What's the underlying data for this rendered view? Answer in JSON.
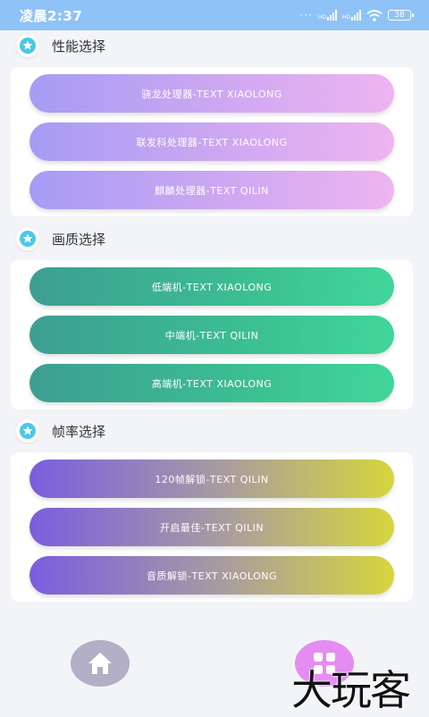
{
  "status_bar": {
    "time": "凌晨2:37",
    "signal_labels": [
      "HD",
      "HD"
    ],
    "battery": "38"
  },
  "sections": [
    {
      "title": "性能选择",
      "buttons": [
        "骁龙处理器-TEXT XIAOLONG",
        "联发科处理器-TEXT XIAOLONG",
        "麒麟处理器-TEXT QILIN"
      ]
    },
    {
      "title": "画质选择",
      "buttons": [
        "低端机-TEXT XIAOLONG",
        "中端机-TEXT QILIN",
        "高端机-TEXT XIAOLONG"
      ]
    },
    {
      "title": "帧率选择",
      "buttons": [
        "120帧解锁-TEXT QILIN",
        "开启最佳-TEXT QILIN",
        "音质解锁-TEXT XIAOLONG"
      ]
    }
  ],
  "bottom_nav": {
    "home_icon": "home-icon",
    "apps_icon": "grid-icon"
  },
  "watermark": "大玩客",
  "colors": {
    "status_bar": "#8fc3f7",
    "star_badge": "#49c9e8",
    "performance": [
      "#a59cf4",
      "#eeb4f0"
    ],
    "quality": [
      "#3d9e92",
      "#40d69a"
    ],
    "framerate": [
      "#7a5ddf",
      "#d6d63e"
    ]
  }
}
